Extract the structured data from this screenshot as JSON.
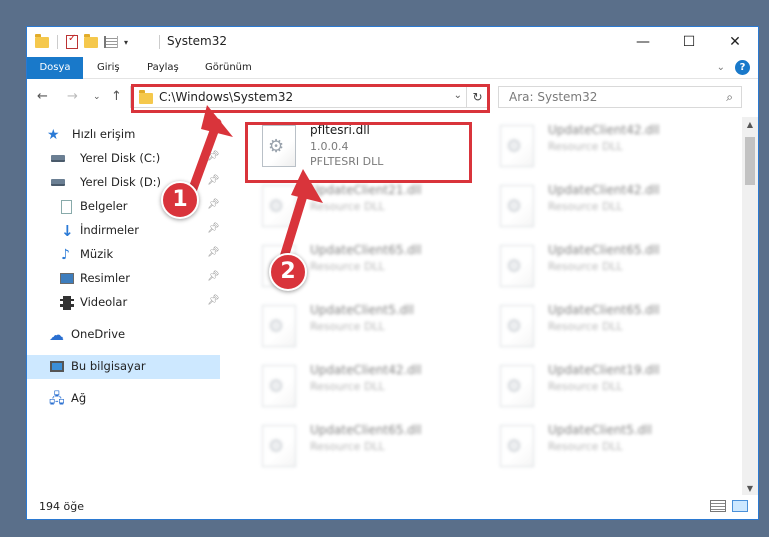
{
  "window": {
    "title": "System32",
    "controls": {
      "minimize": "—",
      "maximize": "☐",
      "close": "✕"
    }
  },
  "ribbon": {
    "tabs": [
      {
        "label": "Dosya",
        "active": true
      },
      {
        "label": "Giriş",
        "active": false
      },
      {
        "label": "Paylaş",
        "active": false
      },
      {
        "label": "Görünüm",
        "active": false
      }
    ],
    "help": "?"
  },
  "address": {
    "path": "C:\\Windows\\System32",
    "search_placeholder": "Ara: System32"
  },
  "sidebar": {
    "items": [
      {
        "label": "Hızlı erişim",
        "icon": "star-icon",
        "pinned": false
      },
      {
        "label": "Yerel Disk (C:)",
        "icon": "disk-icon",
        "pinned": true
      },
      {
        "label": "Yerel Disk (D:)",
        "icon": "disk-icon",
        "pinned": true
      },
      {
        "label": "Belgeler",
        "icon": "documents-icon",
        "pinned": true
      },
      {
        "label": "İndirmeler",
        "icon": "downloads-icon",
        "pinned": true
      },
      {
        "label": "Müzik",
        "icon": "music-icon",
        "pinned": true
      },
      {
        "label": "Resimler",
        "icon": "pictures-icon",
        "pinned": true
      },
      {
        "label": "Videolar",
        "icon": "videos-icon",
        "pinned": true
      },
      {
        "label": "OneDrive",
        "icon": "onedrive-icon",
        "pinned": false
      },
      {
        "label": "Bu bilgisayar",
        "icon": "this-pc-icon",
        "pinned": false,
        "selected": true
      },
      {
        "label": "Ağ",
        "icon": "network-icon",
        "pinned": false
      }
    ]
  },
  "files": {
    "highlighted": {
      "name": "pfltesri.dll",
      "version": "1.0.0.4",
      "description": "PFLTESRI DLL"
    },
    "left_column": [
      {
        "name": "UpdateClient21.dll",
        "description": "Resource DLL"
      },
      {
        "name": "UpdateClient65.dll",
        "description": "Resource DLL"
      },
      {
        "name": "UpdateClient5.dll",
        "description": "Resource DLL"
      },
      {
        "name": "UpdateClient42.dll",
        "description": "Resource DLL"
      },
      {
        "name": "UpdateClient65.dll",
        "description": "Resource DLL"
      }
    ],
    "right_column": [
      {
        "name": "UpdateClient42.dll",
        "description": "Resource DLL"
      },
      {
        "name": "UpdateClient42.dll",
        "description": "Resource DLL"
      },
      {
        "name": "UpdateClient65.dll",
        "description": "Resource DLL"
      },
      {
        "name": "UpdateClient65.dll",
        "description": "Resource DLL"
      },
      {
        "name": "UpdateClient19.dll",
        "description": "Resource DLL"
      },
      {
        "name": "UpdateClient5.dll",
        "description": "Resource DLL"
      }
    ]
  },
  "status": {
    "count": "194 öğe"
  },
  "annotations": {
    "badge1": "1",
    "badge2": "2",
    "highlight_color": "#d9343b"
  }
}
